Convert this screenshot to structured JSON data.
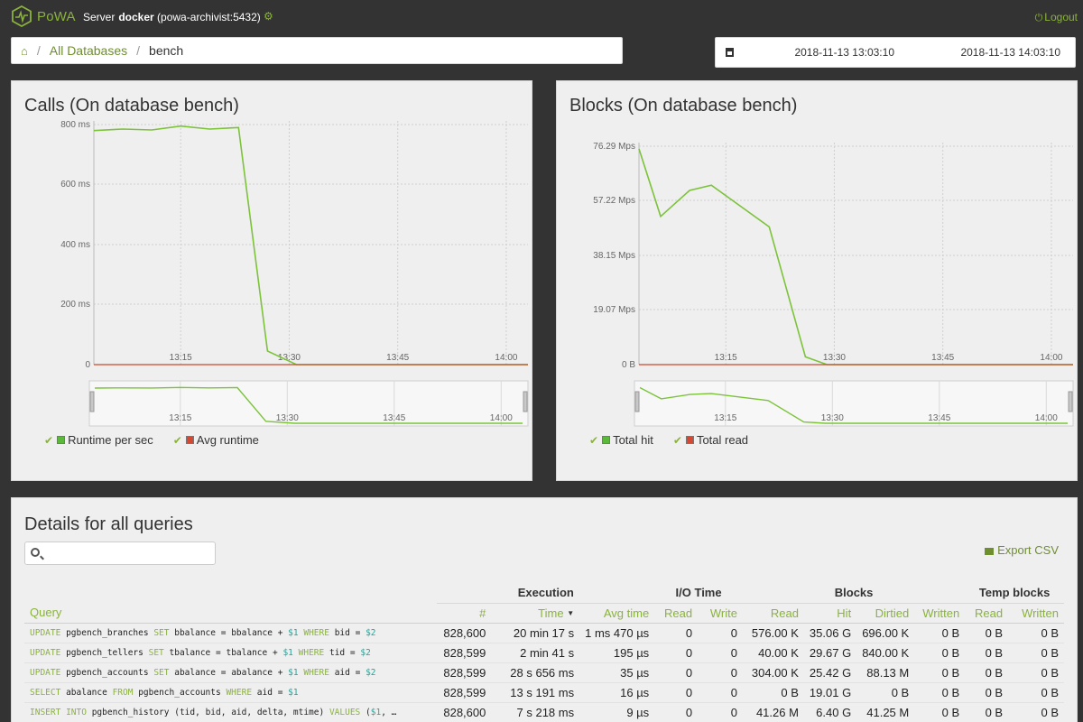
{
  "app": {
    "logo_text": "PoWA",
    "server_label": "Server",
    "server_name": "docker",
    "server_host": "(powa-archivist:5432)",
    "logout_label": "Logout"
  },
  "breadcrumb": {
    "items": [
      "All Databases"
    ],
    "current": "bench"
  },
  "daterange": {
    "from": "2018-11-13 13:03:10",
    "to": "2018-11-13 14:03:10"
  },
  "colors": {
    "accent": "#8ab33b",
    "series_primary": "#7cc33a",
    "series_secondary": "#c9482f"
  },
  "calls_panel": {
    "title": "Calls (On database bench)",
    "legend": [
      {
        "label": "Runtime per sec",
        "color": "#5cb83a"
      },
      {
        "label": "Avg runtime",
        "color": "#d24a33"
      }
    ]
  },
  "blocks_panel": {
    "title": "Blocks (On database bench)",
    "legend": [
      {
        "label": "Total hit",
        "color": "#5cb83a"
      },
      {
        "label": "Total read",
        "color": "#d24a33"
      }
    ]
  },
  "chart_data": [
    {
      "type": "line",
      "title": "Calls (On database bench)",
      "x_ticks": [
        "13:15",
        "13:30",
        "13:45",
        "14:00"
      ],
      "y_ticks": [
        "0",
        "200 ms",
        "400 ms",
        "600 ms",
        "800 ms"
      ],
      "ylim": [
        0,
        800
      ],
      "x": [
        "13:03",
        "13:07",
        "13:11",
        "13:15",
        "13:19",
        "13:23",
        "13:27",
        "13:31",
        "13:35",
        "13:39",
        "13:43",
        "14:03"
      ],
      "series": [
        {
          "name": "Runtime per sec",
          "values": [
            780,
            785,
            782,
            795,
            785,
            790,
            45,
            0,
            0,
            0,
            0,
            0
          ]
        },
        {
          "name": "Avg runtime",
          "values": [
            0,
            0,
            0,
            0,
            0,
            0,
            0,
            0,
            0,
            0,
            0,
            0
          ]
        }
      ],
      "overview_ticks": [
        "13:15",
        "13:30",
        "13:45",
        "14:00"
      ]
    },
    {
      "type": "line",
      "title": "Blocks (On database bench)",
      "x_ticks": [
        "13:15",
        "13:30",
        "13:45",
        "14:00"
      ],
      "y_ticks": [
        "0 B",
        "19.07 Mps",
        "38.15 Mps",
        "57.22 Mps",
        "76.29 Mps"
      ],
      "ylim": [
        0,
        84
      ],
      "x": [
        "13:03",
        "13:06",
        "13:10",
        "13:13",
        "13:21",
        "13:26",
        "13:29",
        "13:32",
        "14:03"
      ],
      "series": [
        {
          "name": "Total hit",
          "values": [
            83,
            57,
            67,
            69,
            53,
            3,
            0,
            0,
            0
          ]
        },
        {
          "name": "Total read",
          "values": [
            0,
            0,
            0,
            0,
            0,
            0,
            0,
            0,
            0
          ]
        }
      ],
      "overview_ticks": [
        "13:15",
        "13:30",
        "13:45",
        "14:00"
      ]
    }
  ],
  "details": {
    "title": "Details for all queries",
    "search_placeholder": "",
    "export_label": "Export CSV",
    "groups": {
      "execution": "Execution",
      "io_time": "I/O Time",
      "blocks": "Blocks",
      "temp_blocks": "Temp blocks"
    },
    "columns": [
      "Query",
      "#",
      "Time",
      "Avg time",
      "Read",
      "Write",
      "Read",
      "Hit",
      "Dirtied",
      "Written",
      "Read",
      "Written"
    ],
    "rows": [
      {
        "query": "UPDATE pgbench_branches SET bbalance = bbalance + $1 WHERE bid = $2",
        "calls": "828,600",
        "time": "20 min 17 s",
        "avg": "1 ms 470 µs",
        "io_read": "0",
        "io_write": "0",
        "blk_read": "576.00 K",
        "blk_hit": "35.06 G",
        "blk_dirtied": "696.00 K",
        "blk_written": "0 B",
        "tmp_read": "0 B",
        "tmp_written": "0 B"
      },
      {
        "query": "UPDATE pgbench_tellers SET tbalance = tbalance + $1 WHERE tid = $2",
        "calls": "828,599",
        "time": "2 min 41 s",
        "avg": "195 µs",
        "io_read": "0",
        "io_write": "0",
        "blk_read": "40.00 K",
        "blk_hit": "29.67 G",
        "blk_dirtied": "840.00 K",
        "blk_written": "0 B",
        "tmp_read": "0 B",
        "tmp_written": "0 B"
      },
      {
        "query": "UPDATE pgbench_accounts SET abalance = abalance + $1 WHERE aid = $2",
        "calls": "828,599",
        "time": "28 s 656 ms",
        "avg": "35 µs",
        "io_read": "0",
        "io_write": "0",
        "blk_read": "304.00 K",
        "blk_hit": "25.42 G",
        "blk_dirtied": "88.13 M",
        "blk_written": "0 B",
        "tmp_read": "0 B",
        "tmp_written": "0 B"
      },
      {
        "query": "SELECT abalance FROM pgbench_accounts WHERE aid = $1",
        "calls": "828,599",
        "time": "13 s 191 ms",
        "avg": "16 µs",
        "io_read": "0",
        "io_write": "0",
        "blk_read": "0 B",
        "blk_hit": "19.01 G",
        "blk_dirtied": "0 B",
        "blk_written": "0 B",
        "tmp_read": "0 B",
        "tmp_written": "0 B"
      },
      {
        "query": "INSERT INTO pgbench_history (tid, bid, aid, delta, mtime) VALUES ($1, …",
        "calls": "828,600",
        "time": "7 s 218 ms",
        "avg": "9 µs",
        "io_read": "0",
        "io_write": "0",
        "blk_read": "41.26 M",
        "blk_hit": "6.40 G",
        "blk_dirtied": "41.25 M",
        "blk_written": "0 B",
        "tmp_read": "0 B",
        "tmp_written": "0 B"
      }
    ]
  }
}
